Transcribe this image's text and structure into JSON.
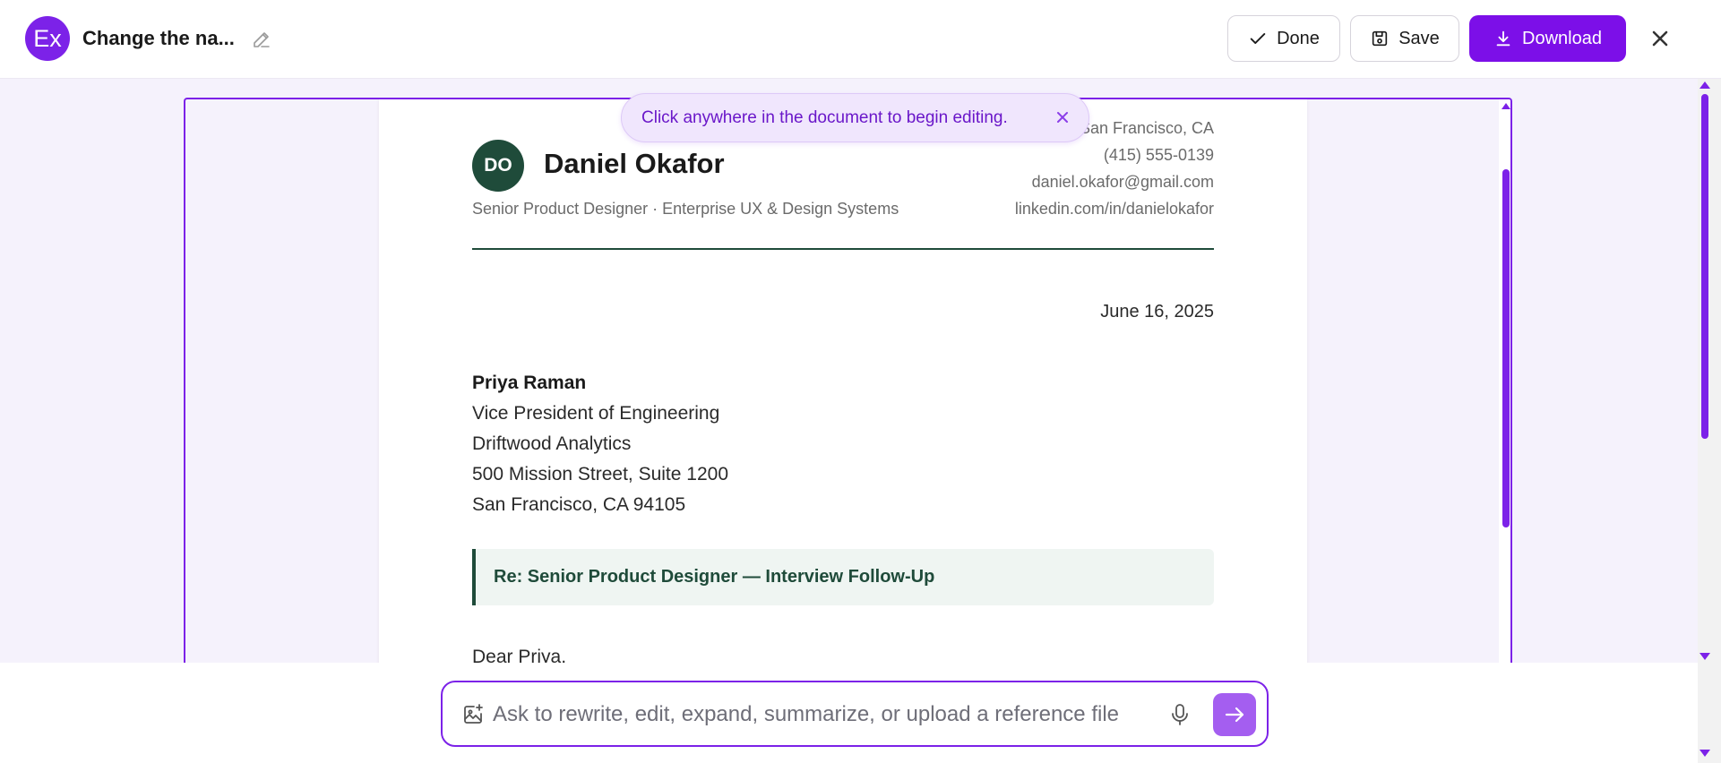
{
  "app": {
    "badge_text": "Ex",
    "document_title": "Change the na...",
    "accent_color": "#7c22e8"
  },
  "toolbar": {
    "done_label": "Done",
    "save_label": "Save",
    "download_label": "Download"
  },
  "toast": {
    "message": "Click anywhere in the document to begin editing."
  },
  "letter": {
    "initials": "DO",
    "sender_name": "Daniel Okafor",
    "sender_tagline": "Senior Product Designer · Enterprise UX & Design Systems",
    "contact": {
      "location": "San Francisco, CA",
      "phone": "(415) 555-0139",
      "email": "daniel.okafor@gmail.com",
      "linkedin": "linkedin.com/in/danielokafor"
    },
    "date": "June 16, 2025",
    "recipient": {
      "name": "Priya Raman",
      "title": "Vice President of Engineering",
      "company": "Driftwood Analytics",
      "street": "500 Mission Street, Suite 1200",
      "city": "San Francisco, CA 94105"
    },
    "subject": "Re: Senior Product Designer — Interview Follow-Up",
    "salutation": "Dear Priya,"
  },
  "composer": {
    "placeholder": "Ask to rewrite, edit, expand, summarize, or upload a reference file"
  },
  "icons": {
    "rename": "pencil-icon",
    "done": "check-icon",
    "save": "save-icon",
    "download": "download-icon",
    "close": "close-icon",
    "attach": "image-plus-icon",
    "mic": "mic-icon",
    "send": "arrow-right-icon"
  }
}
